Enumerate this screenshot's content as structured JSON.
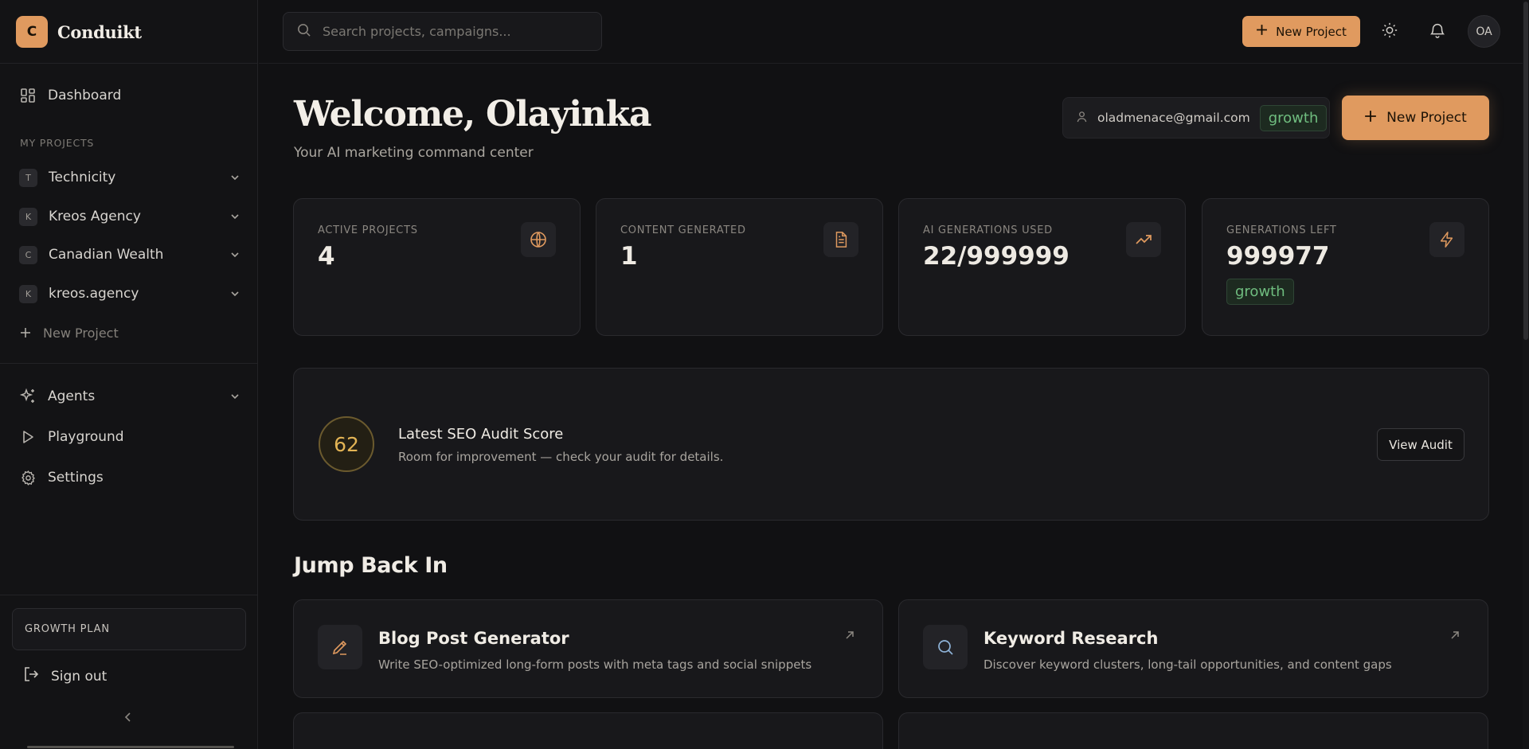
{
  "brand": {
    "logo_letter": "C",
    "name": "Conduikt"
  },
  "sidebar": {
    "dashboard": "Dashboard",
    "projects_label": "MY PROJECTS",
    "projects": [
      {
        "initial": "T",
        "name": "Technicity"
      },
      {
        "initial": "K",
        "name": "Kreos Agency"
      },
      {
        "initial": "C",
        "name": "Canadian Wealth"
      },
      {
        "initial": "K",
        "name": "kreos.agency"
      }
    ],
    "new_project": "New Project",
    "agents": "Agents",
    "playground": "Playground",
    "settings": "Settings",
    "plan": "GROWTH PLAN",
    "sign_out": "Sign out"
  },
  "topbar": {
    "search_placeholder": "Search projects, campaigns...",
    "new_project": "New Project",
    "avatar_initials": "OA"
  },
  "header": {
    "welcome": "Welcome, Olayinka",
    "subtitle": "Your AI marketing command center",
    "email": "oladmenace@gmail.com",
    "plan_tag": "growth",
    "new_project": "New Project"
  },
  "stats": [
    {
      "label": "ACTIVE PROJECTS",
      "value": "4",
      "icon": "globe-icon"
    },
    {
      "label": "CONTENT GENERATED",
      "value": "1",
      "icon": "document-icon"
    },
    {
      "label": "AI GENERATIONS USED",
      "value": "22/999999",
      "icon": "trending-up-icon"
    },
    {
      "label": "GENERATIONS LEFT",
      "value": "999977",
      "icon": "lightning-icon",
      "tag": "growth"
    }
  ],
  "seo": {
    "score": "62",
    "title": "Latest SEO Audit Score",
    "description": "Room for improvement — check your audit for details.",
    "button": "View Audit"
  },
  "jump_back": {
    "title": "Jump Back In",
    "tools": [
      {
        "title": "Blog Post Generator",
        "description": "Write SEO-optimized long-form posts with meta tags and social snippets",
        "icon": "pencil-icon"
      },
      {
        "title": "Keyword Research",
        "description": "Discover keyword clusters, long-tail opportunities, and content gaps",
        "icon": "search-icon"
      }
    ]
  },
  "colors": {
    "accent": "#e09a5f",
    "background": "#111113",
    "card": "#18181b",
    "growth_green": "#6fbd7f",
    "score_gold": "#e3b455"
  }
}
